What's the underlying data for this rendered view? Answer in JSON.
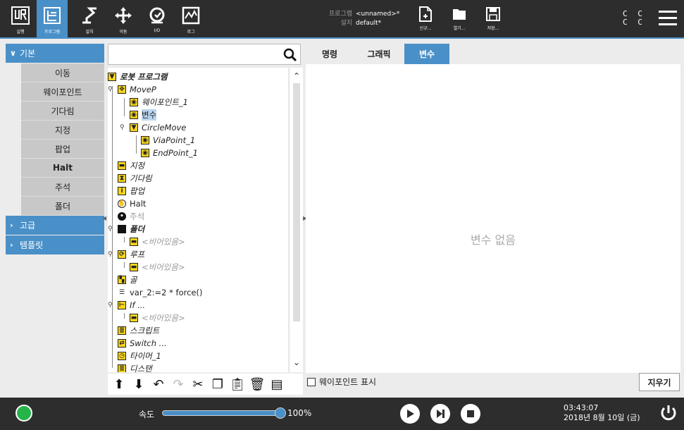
{
  "header": {
    "nav": [
      {
        "label": "실행",
        "icon": "run-icon"
      },
      {
        "label": "프로그램",
        "icon": "program-icon"
      },
      {
        "label": "설치",
        "icon": "installation-icon"
      },
      {
        "label": "이동",
        "icon": "move-icon"
      },
      {
        "label": "I/O",
        "icon": "io-icon"
      },
      {
        "label": "로그",
        "icon": "log-icon"
      }
    ],
    "program_key": "프로그램",
    "program_value": "<unnamed>*",
    "install_key": "설치",
    "install_value": "default*",
    "file_buttons": [
      {
        "label": "신규...",
        "icon": "new-file-icon"
      },
      {
        "label": "열기...",
        "icon": "open-folder-icon"
      },
      {
        "label": "저장...",
        "icon": "save-icon"
      }
    ],
    "cc_line1": "C C",
    "cc_line2": "C C"
  },
  "sidebar": {
    "basic_label": "기본",
    "items": [
      "이동",
      "웨이포인트",
      "기다림",
      "지정",
      "팝업",
      "Halt",
      "주석",
      "폴더"
    ],
    "advanced_label": "고급",
    "template_label": "템플릿"
  },
  "search": {
    "placeholder": ""
  },
  "tree": {
    "root": "로봇 프로그램",
    "movep": "MoveP",
    "waypoint1": "웨이포인트_1",
    "variable": "변수",
    "circlemove": "CircleMove",
    "viapoint": "ViaPoint_1",
    "endpoint": "EndPoint_1",
    "assign": "지정",
    "wait": "기다림",
    "popup": "팝업",
    "halt": "Halt",
    "comment": "주석",
    "folder": "폴더",
    "empty1": "<비어있음>",
    "loop": "루프",
    "empty2": "<비어있음>",
    "goal": "골",
    "var_assign": "var_2:=2 * force()",
    "if": "If ...",
    "empty3": "<비어있음>",
    "script": "스크립트",
    "switch": "Switch ...",
    "timer": "타이머_1",
    "last": "디스탠"
  },
  "tabs": [
    "명령",
    "그래픽",
    "변수"
  ],
  "active_tab": "변수",
  "content": {
    "no_variables": "변수 없음",
    "show_waypoints": "웨이포인트 표시",
    "clear_button": "지우기"
  },
  "footer": {
    "speed_label": "속도",
    "speed_value": "100%",
    "speed_fraction": 1.0,
    "time": "03:43:07",
    "date": "2018년 8월 10일 (금)"
  },
  "colors": {
    "accent": "#4a90c8",
    "header_bg": "#2d2d2d",
    "status_green": "#26b34a",
    "node_yellow": "#f6d51c"
  }
}
